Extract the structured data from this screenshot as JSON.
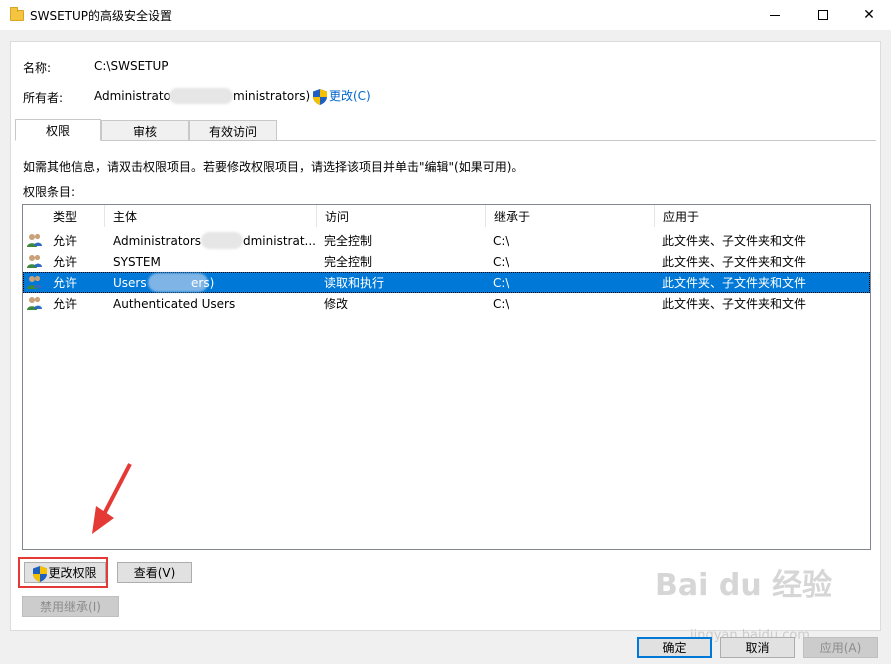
{
  "window": {
    "title": "SWSETUP的高级安全设置"
  },
  "header": {
    "name_label": "名称:",
    "name_value": "C:\\SWSETUP",
    "owner_label": "所有者:",
    "owner_value_left": "Administrato",
    "owner_value_right": "ministrators)",
    "change_link": "更改(C)"
  },
  "tabs": [
    {
      "label": "权限"
    },
    {
      "label": "审核"
    },
    {
      "label": "有效访问"
    }
  ],
  "info_text": "如需其他信息，请双击权限项目。若要修改权限项目，请选择该项目并单击\"编辑\"(如果可用)。",
  "list_label": "权限条目:",
  "columns": [
    "类型",
    "主体",
    "访问",
    "继承于",
    "应用于"
  ],
  "rows": [
    {
      "type": "允许",
      "principal": "Administrators",
      "principal_tail": "dministrat...",
      "access": "完全控制",
      "inherited": "C:\\",
      "applies": "此文件夹、子文件夹和文件",
      "selected": false
    },
    {
      "type": "允许",
      "principal": "SYSTEM",
      "principal_tail": "",
      "access": "完全控制",
      "inherited": "C:\\",
      "applies": "此文件夹、子文件夹和文件",
      "selected": false
    },
    {
      "type": "允许",
      "principal": "Users",
      "principal_tail": "ers)",
      "access": "读取和执行",
      "inherited": "C:\\",
      "applies": "此文件夹、子文件夹和文件",
      "selected": true
    },
    {
      "type": "允许",
      "principal": "Authenticated Users",
      "principal_tail": "",
      "access": "修改",
      "inherited": "C:\\",
      "applies": "此文件夹、子文件夹和文件",
      "selected": false
    }
  ],
  "buttons": {
    "change_permissions": "更改权限",
    "view": "查看(V)",
    "disable_inheritance": "禁用继承(I)",
    "ok": "确定",
    "cancel": "取消",
    "apply": "应用(A)"
  },
  "watermark": {
    "main": "Bai du 经验",
    "sub": "jingyan.baidu.com"
  },
  "colors": {
    "selection": "#0078d7",
    "highlight_frame": "#e53935"
  }
}
